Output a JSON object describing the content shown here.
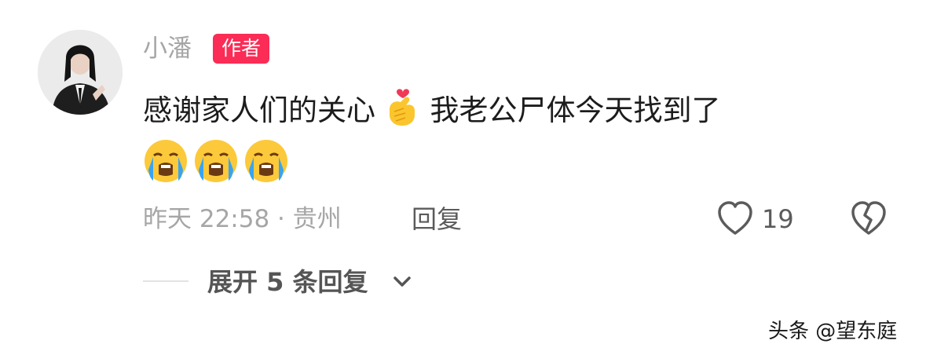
{
  "comment": {
    "username": "小潘",
    "author_badge": "作者",
    "text_part1": "感谢家人们的关心",
    "text_part2": "我老公尸体今天找到了",
    "inline_emoji": "finger-heart-emoji",
    "trailing_emojis": [
      "loudly-crying-face-emoji",
      "loudly-crying-face-emoji",
      "loudly-crying-face-emoji"
    ],
    "meta": "昨天 22:58 · 贵州",
    "reply_label": "回复",
    "like_count": "19",
    "expand_label": "展开 5 条回复"
  },
  "watermark": "头条 @望东庭",
  "colors": {
    "badge": "#fb2c55",
    "secondary_text": "#a6a6a6",
    "primary_text": "#1c1c1c"
  }
}
